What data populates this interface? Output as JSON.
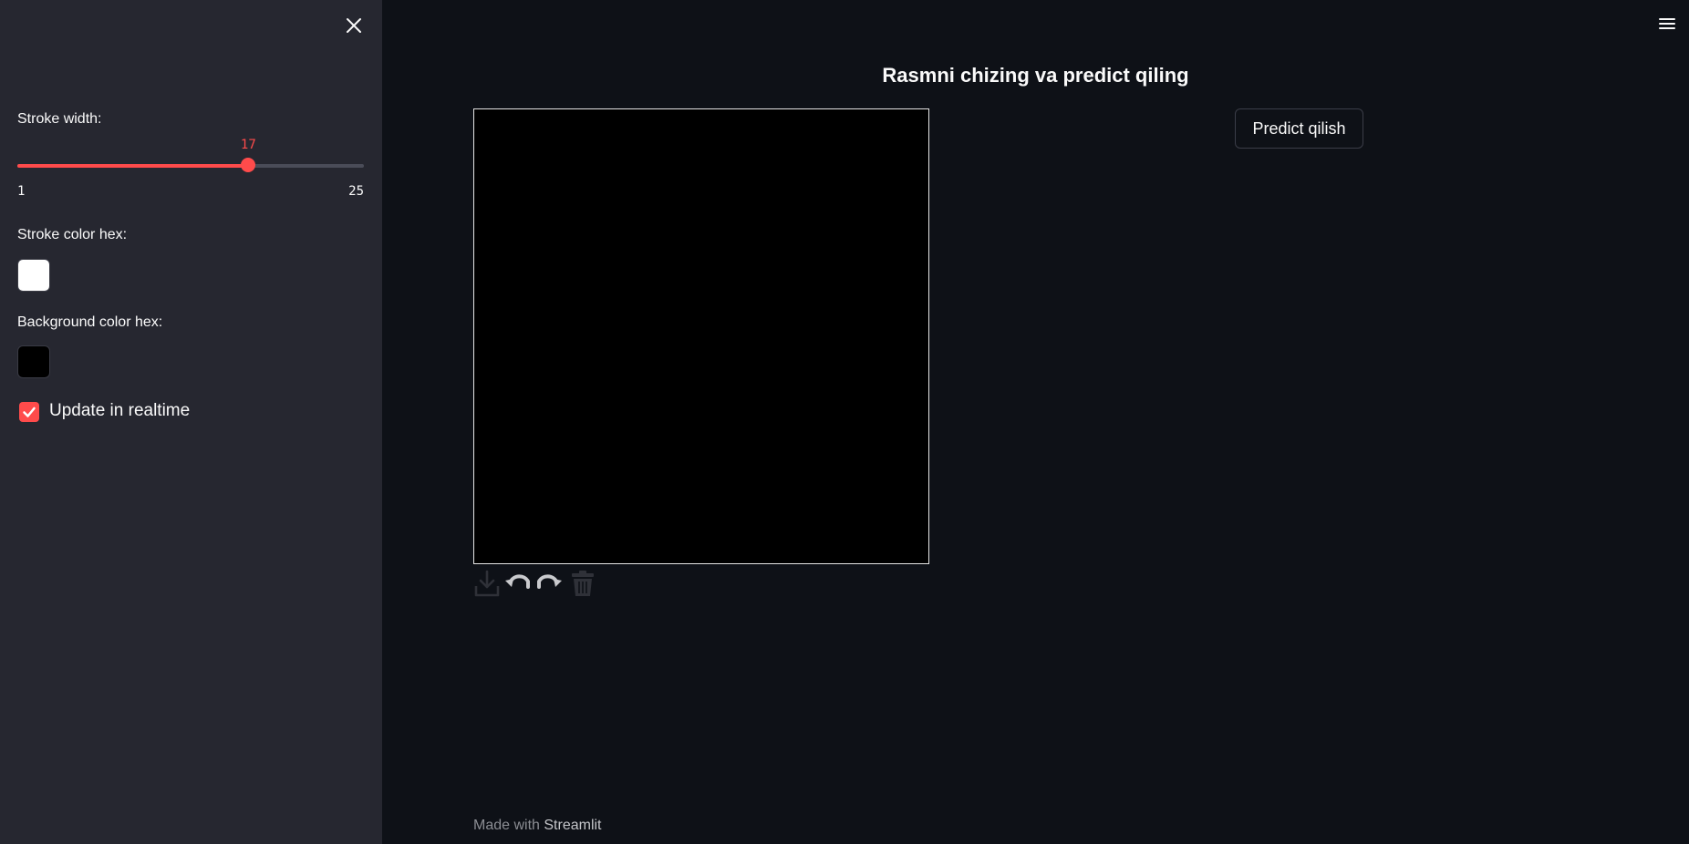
{
  "sidebar": {
    "close_icon": "close-icon",
    "stroke_width": {
      "label": "Stroke width:",
      "value": 17,
      "value_text": "17",
      "min": 1,
      "max": 25,
      "min_text": "1",
      "max_text": "25"
    },
    "stroke_color": {
      "label": "Stroke color hex:",
      "value": "#ffffff"
    },
    "background_color": {
      "label": "Background color hex:",
      "value": "#000000"
    },
    "realtime": {
      "label": "Update in realtime",
      "checked": true
    }
  },
  "header": {
    "menu_icon": "hamburger-menu-icon"
  },
  "main": {
    "title": "Rasmni chizing va predict qiling",
    "canvas": {
      "background": "#000000",
      "toolbar": [
        "download-icon",
        "undo-icon",
        "redo-icon",
        "trash-icon"
      ]
    },
    "predict_button_label": "Predict qilish"
  },
  "footer": {
    "prefix": "Made with ",
    "link": "Streamlit"
  },
  "colors": {
    "accent": "#ff4b4b",
    "sidebar_bg": "#262730",
    "main_bg": "#0e1117"
  }
}
